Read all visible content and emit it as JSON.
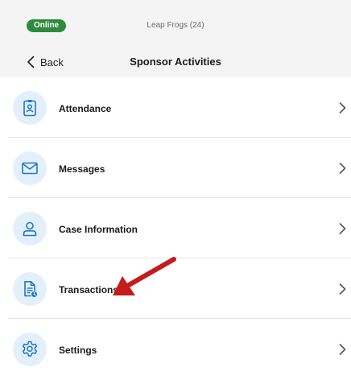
{
  "header": {
    "status_badge": "Online",
    "group_name": "Leap Frogs (24)",
    "back_label": "Back",
    "title": "Sponsor Activities"
  },
  "colors": {
    "status_green": "#2e8b3e",
    "icon_blue": "#1f77c6",
    "icon_circle_bg": "#e3f0fc",
    "annotation_arrow": "#c41b1b"
  },
  "menu": {
    "items": [
      {
        "label": "Attendance",
        "icon": "id-badge-icon"
      },
      {
        "label": "Messages",
        "icon": "envelope-icon"
      },
      {
        "label": "Case Information",
        "icon": "person-icon"
      },
      {
        "label": "Transactions",
        "icon": "document-clock-icon"
      },
      {
        "label": "Settings",
        "icon": "gear-icon"
      }
    ]
  },
  "annotation": {
    "type": "red-arrow",
    "points_to": "Transactions"
  }
}
